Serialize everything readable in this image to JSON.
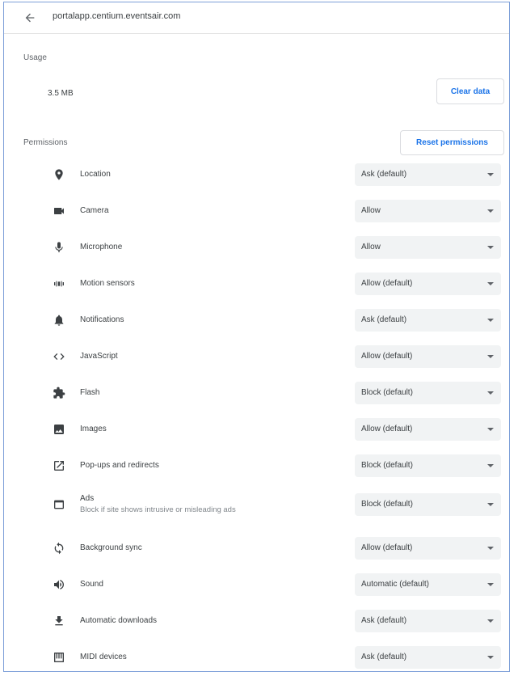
{
  "header": {
    "back_icon": "arrow-back-icon",
    "origin": "portalapp.centium.eventsair.com"
  },
  "usage": {
    "label": "Usage",
    "value": "3.5 MB",
    "clear_label": "Clear data"
  },
  "permissions": {
    "label": "Permissions",
    "reset_label": "Reset permissions",
    "items": [
      {
        "label": "Location",
        "value": "Ask (default)",
        "icon": "location-icon"
      },
      {
        "label": "Camera",
        "value": "Allow",
        "icon": "camera-icon"
      },
      {
        "label": "Microphone",
        "value": "Allow",
        "icon": "microphone-icon"
      },
      {
        "label": "Motion sensors",
        "value": "Allow (default)",
        "icon": "motion-sensors-icon"
      },
      {
        "label": "Notifications",
        "value": "Ask (default)",
        "icon": "notifications-icon"
      },
      {
        "label": "JavaScript",
        "value": "Allow (default)",
        "icon": "code-icon"
      },
      {
        "label": "Flash",
        "value": "Block (default)",
        "icon": "puzzle-icon"
      },
      {
        "label": "Images",
        "value": "Allow (default)",
        "icon": "image-icon"
      },
      {
        "label": "Pop-ups and redirects",
        "value": "Block (default)",
        "icon": "open-in-new-icon"
      },
      {
        "label": "Ads",
        "sublabel": "Block if site shows intrusive or misleading ads",
        "value": "Block (default)",
        "icon": "ads-icon"
      },
      {
        "label": "Background sync",
        "value": "Allow (default)",
        "icon": "sync-icon"
      },
      {
        "label": "Sound",
        "value": "Automatic (default)",
        "icon": "volume-icon"
      },
      {
        "label": "Automatic downloads",
        "value": "Ask (default)",
        "icon": "download-icon"
      },
      {
        "label": "MIDI devices",
        "value": "Ask (default)",
        "icon": "piano-icon"
      }
    ]
  },
  "colors": {
    "accent": "#1a73e8",
    "frame_border": "#7d9fd8",
    "select_bg": "#f1f3f4",
    "icon": "#5f6368"
  }
}
